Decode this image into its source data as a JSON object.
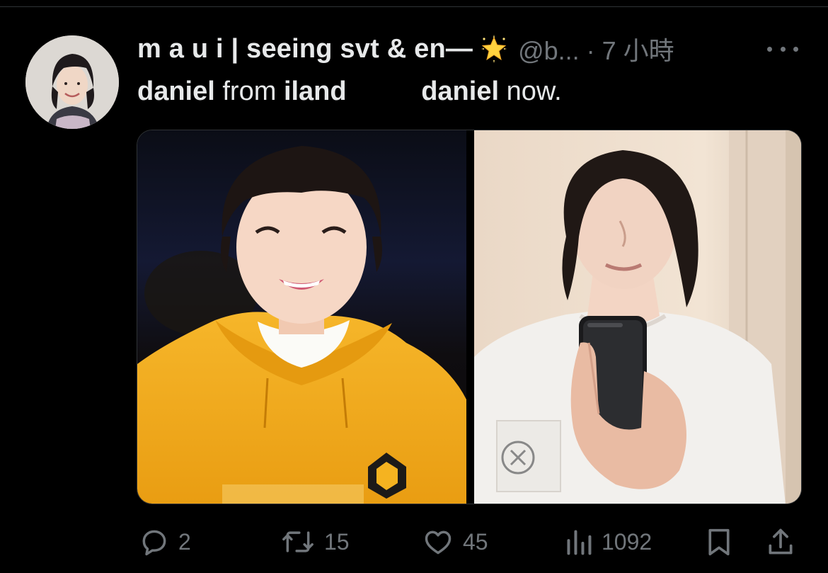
{
  "tweet": {
    "display_name": "m a u i | seeing svt & en—",
    "display_name_emoji": "sparkle-star-emoji",
    "handle_meta": "@b... · 7 小時",
    "text": {
      "line_parts": [
        {
          "text": "daniel",
          "bold": true
        },
        {
          "text": " from ",
          "bold": false
        },
        {
          "text": "iland",
          "bold": true
        },
        {
          "text": "          ",
          "bold": false
        },
        {
          "text": "daniel",
          "bold": true
        },
        {
          "text": " now.",
          "bold": false
        }
      ]
    },
    "media": {
      "left_image": "photo-young-man-yellow-hoodie",
      "right_image": "photo-mirror-selfie-white-tshirt"
    },
    "actions": {
      "replies": "2",
      "retweets": "15",
      "likes": "45",
      "views": "1092"
    }
  },
  "icons": {
    "more": "more-horizontal-icon",
    "reply": "reply-bubble-icon",
    "retweet": "retweet-icon",
    "like": "heart-icon",
    "views": "views-chart-icon",
    "bookmark": "bookmark-icon",
    "share": "share-icon"
  },
  "colors": {
    "background": "#000000",
    "primary_text": "#e7e9ea",
    "secondary_text": "#71767b",
    "border": "#2f3336",
    "hoodie_yellow": "#f3b21c"
  }
}
